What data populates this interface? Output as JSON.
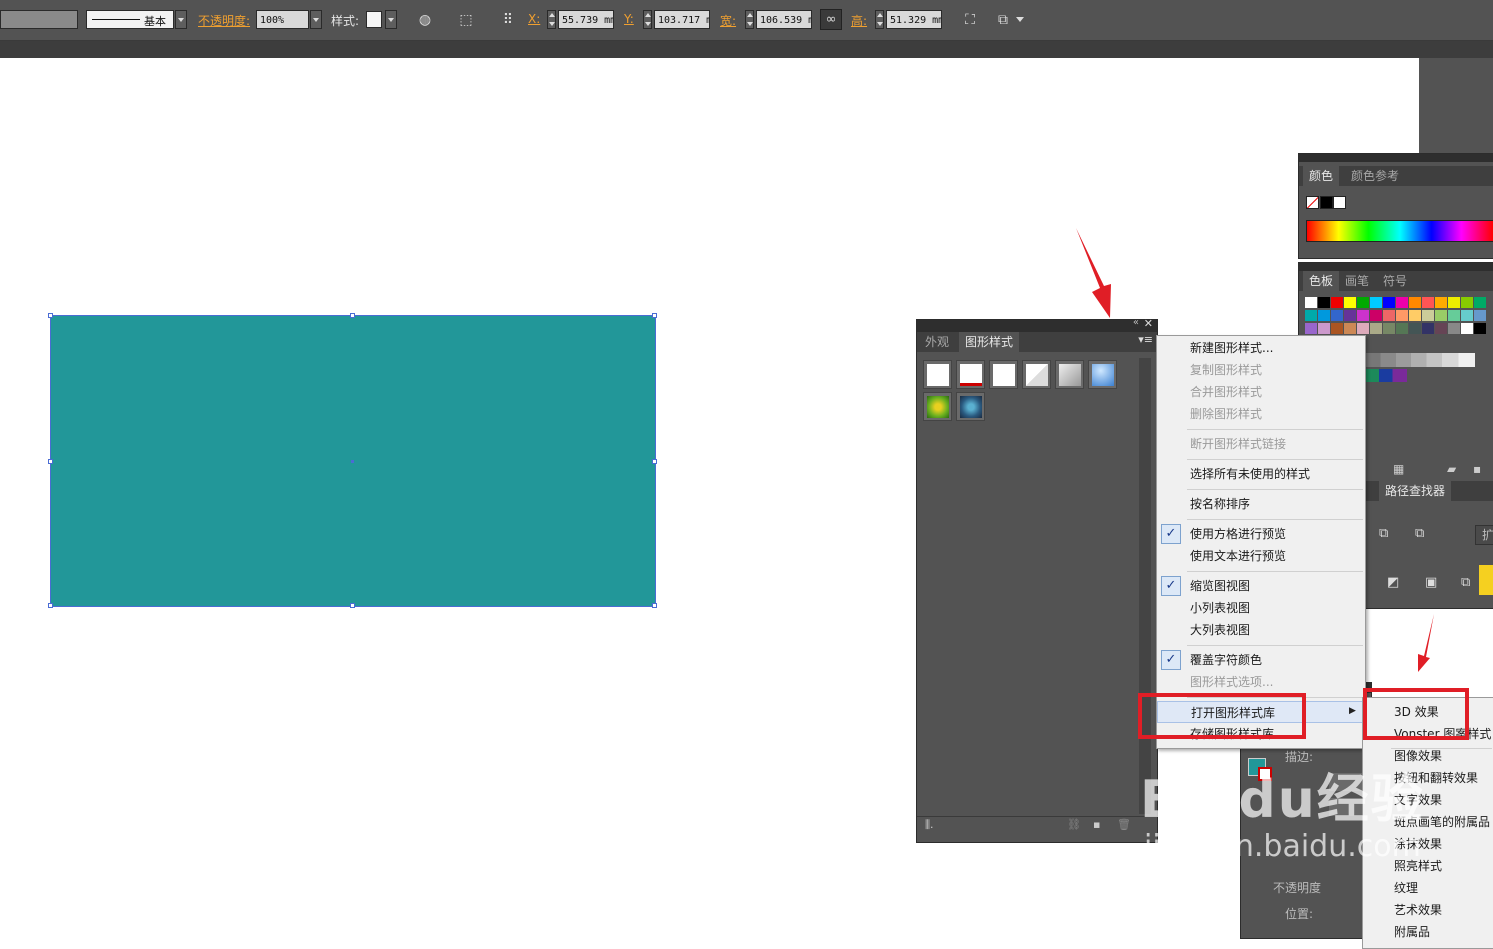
{
  "control_bar": {
    "stroke_style_label": "基本",
    "opacity_label": "不透明度:",
    "opacity_value": "100%",
    "style_label": "样式:",
    "x_label": "X:",
    "x_value": "55.739 mm",
    "y_label": "Y:",
    "y_value": "103.717 mm",
    "width_label": "宽:",
    "width_value": "106.539 mm",
    "height_label": "高:",
    "height_value": "51.329 mm"
  },
  "canvas": {
    "rect_color": "#229799",
    "selection_color": "#4a6cd4"
  },
  "graphic_styles_panel": {
    "tabs": [
      "外观",
      "图形样式"
    ],
    "active_tab": "图形样式"
  },
  "context_menu": {
    "items": [
      {
        "label": "新建图形样式...",
        "disabled": false,
        "checked": false
      },
      {
        "label": "复制图形样式",
        "disabled": true,
        "checked": false
      },
      {
        "label": "合并图形样式",
        "disabled": true,
        "checked": false
      },
      {
        "label": "删除图形样式",
        "disabled": true,
        "checked": false
      },
      {
        "label": "断开图形样式链接",
        "disabled": true,
        "checked": false
      },
      {
        "label": "选择所有未使用的样式",
        "disabled": false,
        "checked": false
      },
      {
        "label": "按名称排序",
        "disabled": false,
        "checked": false
      },
      {
        "label": "使用方格进行预览",
        "disabled": false,
        "checked": true
      },
      {
        "label": "使用文本进行预览",
        "disabled": false,
        "checked": false
      },
      {
        "label": "缩览图视图",
        "disabled": false,
        "checked": true
      },
      {
        "label": "小列表视图",
        "disabled": false,
        "checked": false
      },
      {
        "label": "大列表视图",
        "disabled": false,
        "checked": false
      },
      {
        "label": "覆盖字符颜色",
        "disabled": false,
        "checked": true
      },
      {
        "label": "图形样式选项...",
        "disabled": true,
        "checked": false
      },
      {
        "label": "打开图形样式库",
        "disabled": false,
        "checked": false,
        "highlighted": true
      },
      {
        "label": "存储图形样式库...",
        "disabled": false,
        "checked": false
      }
    ]
  },
  "submenu": {
    "items": [
      "3D 效果",
      "Vonster 图案样式",
      "图像效果",
      "按钮和翻转效果",
      "文字效果",
      "斑点画笔的附属品",
      "涂抹效果",
      "照亮样式",
      "纹理",
      "艺术效果",
      "附属品"
    ]
  },
  "color_panel": {
    "tabs": [
      "颜色",
      "颜色参考"
    ]
  },
  "swatches_panel": {
    "tabs": [
      "色板",
      "画笔",
      "符号"
    ],
    "pathfinder_tab": "路径查找器",
    "expand_label": "扩展"
  },
  "appearance_panel": {
    "stroke_label": "描边:",
    "opacity_label": "不透明度",
    "position_label": "位置:"
  },
  "watermark": {
    "brand": "Baidu经验",
    "url": "jingyan.baidu.com"
  },
  "annotation_color": "#e01e26"
}
